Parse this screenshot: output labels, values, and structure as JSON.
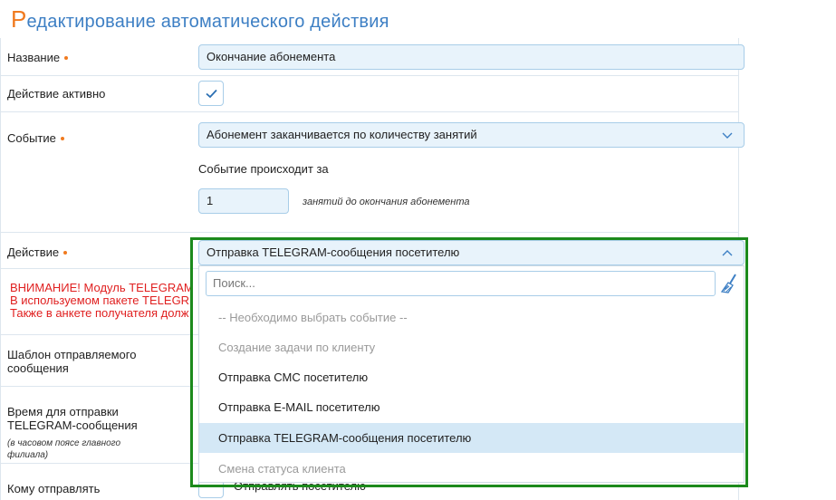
{
  "page": {
    "title_first_letter": "Р",
    "title_rest": "едактирование автоматического действия"
  },
  "form": {
    "name": {
      "label": "Название",
      "value": "Окончание абонемента"
    },
    "active": {
      "label": "Действие активно",
      "checked": true
    },
    "event": {
      "label": "Событие",
      "value": "Абонемент заканчивается по количеству занятий",
      "occurs_label": "Событие происходит за",
      "occurs_value": "1",
      "occurs_suffix": "занятий до окончания абонемента"
    },
    "action": {
      "label": "Действие",
      "value": "Отправка TELEGRAM-сообщения посетителю"
    },
    "warning": {
      "line1": "ВНИМАНИЕ! Модуль TELEGRAM",
      "line2": "В используемом пакете TELEGR",
      "line3": "Также в анкете получателя долж"
    },
    "template": {
      "label_line1": "Шаблон отправляемого",
      "label_line2": "сообщения"
    },
    "send_time": {
      "label_line1": "Время для отправки",
      "label_line2": "TELEGRAM-сообщения",
      "hint_line1": "(в часовом поясе главного",
      "hint_line2": "филиала)"
    },
    "recipient": {
      "label": "Кому отправлять",
      "option": "Отправлять посетителю"
    }
  },
  "dropdown": {
    "search_placeholder": "Поиск...",
    "options": [
      {
        "label": "-- Необходимо выбрать событие --",
        "state": "disabled"
      },
      {
        "label": "Создание задачи по клиенту",
        "state": "disabled"
      },
      {
        "label": "Отправка СМС посетителю",
        "state": "enabled"
      },
      {
        "label": "Отправка E-MAIL посетителю",
        "state": "enabled"
      },
      {
        "label": "Отправка TELEGRAM-сообщения посетителю",
        "state": "selected"
      },
      {
        "label": "Смена статуса клиента",
        "state": "disabled"
      }
    ]
  },
  "colors": {
    "accent": "#3d7fc4",
    "orange": "#f07a1f",
    "warning": "#e02020",
    "highlight": "#1c8a1c",
    "selected": "#d4e8f6"
  },
  "icons": {
    "checkmark": "check-icon",
    "chevron": "chevron-down-icon",
    "chevron_open": "chevron-up-icon",
    "clear": "broom-icon"
  }
}
